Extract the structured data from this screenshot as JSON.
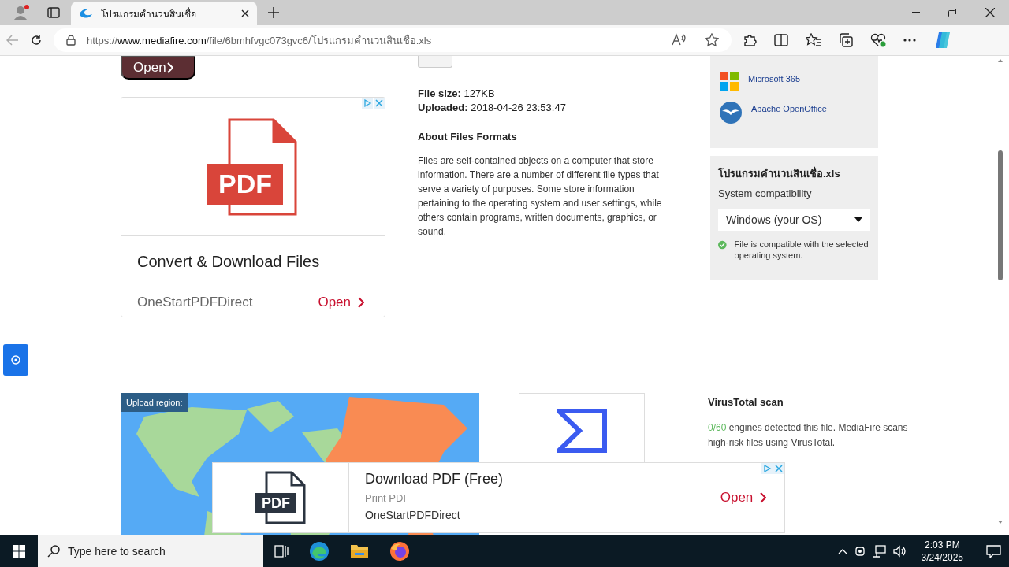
{
  "browser": {
    "tabs": [
      {
        "title": "โปรแกรมคำนวนสินเชื่อ",
        "selected": true
      }
    ],
    "url": {
      "scheme": "https://",
      "host": "www.mediafire.com",
      "path": "/file/6bmhfvgc073gvc6/โปรแกรมคำนวนสินเชื่อ.xls"
    }
  },
  "page": {
    "open_bar": {
      "label": "Open"
    },
    "ad": {
      "badge": "PDF",
      "title": "Convert & Download Files",
      "advertiser": "OneStartPDFDirect",
      "cta": "Open"
    },
    "file_info": [
      {
        "label": "File size:",
        "value": "127KB"
      },
      {
        "label": "Uploaded:",
        "value": "2018-04-26 23:53:47"
      }
    ],
    "about": {
      "heading": "About Files Formats",
      "text": "Files are self-contained objects on a computer that store information. There are a number of different file types that serve a variety of purposes. Some store information pertaining to the operating system and user settings, while others contain programs, written documents, graphics, or sound."
    },
    "open_with": [
      {
        "name": "Microsoft 365",
        "kind": "windows"
      },
      {
        "name": "Apache OpenOffice",
        "kind": "openoffice"
      }
    ],
    "compat": {
      "file_name": "โปรแกรมคำนวนสินเชื่อ.xls",
      "label": "System compatibility",
      "os": "Windows (your OS)",
      "status": "File is compatible with the selected operating system."
    },
    "upload_region": {
      "label": "Upload region:"
    },
    "virustotal": {
      "title": "VirusTotal scan",
      "count": "0/60",
      "text": " engines detected this file. MediaFire scans high-risk files using VirusTotal."
    }
  },
  "floating_ad": {
    "badge": "PDF",
    "title": "Download PDF (Free)",
    "subtitle": "Print PDF",
    "advertiser": "OneStartPDFDirect",
    "cta": "Open"
  },
  "taskbar": {
    "search_placeholder": "Type here to search",
    "time": "2:03 PM",
    "date": "3/24/2025"
  }
}
